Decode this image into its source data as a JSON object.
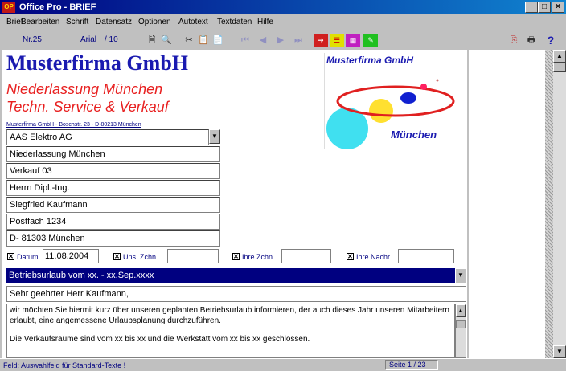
{
  "window": {
    "app_icon": "OP",
    "title": "Office Pro - BRIEF"
  },
  "menu": [
    "Brief",
    "Bearbeiten",
    "Schrift",
    "Datensatz",
    "Optionen",
    "Autotext",
    "Textdaten",
    "Hilfe"
  ],
  "toolbar": {
    "number": "Nr.25",
    "font": "Arial",
    "size": "/ 10",
    "help": "?"
  },
  "letterhead": {
    "company": "Musterfirma GmbH",
    "branch_line1": "Niederlassung München",
    "branch_line2": "Techn. Service & Verkauf",
    "sender_line": "Musterfirma GmbH - Boschstr. 23 - D-80213 München"
  },
  "logo": {
    "title": "Musterfirma GmbH",
    "city": "München"
  },
  "address": [
    "AAS Elektro AG",
    "Niederlassung München",
    "Verkauf 03",
    "Herrn Dipl.-Ing.",
    "Siegfried Kaufmann",
    "Postfach 1234",
    "D- 81303 München"
  ],
  "reference_fields": {
    "datum_label": "Datum",
    "datum_value": "11.08.2004",
    "uns_zchn_label": "Uns. Zchn.",
    "ihre_zchn_label": "Ihre Zchn.",
    "ihre_nachr_label": "Ihre Nachr."
  },
  "subject": "Betriebsurlaub vom xx. - xx.Sep.xxxx",
  "salutation": "Sehr geehrter Herr Kaufmann,",
  "body": {
    "paragraph1": "wir möchten Sie hiermit kurz über unseren geplanten Betriebsurlaub informieren, der auch dieses Jahr unseren Mitarbeitern erlaubt, eine angemessene Urlaubsplanung durchzuführen.",
    "paragraph2": "Die Verkaufsräume sind vom xx bis xx  und die Werkstatt vom xx bis xx geschlossen."
  },
  "status": {
    "message": "Feld: Auswahlfeld für Standard-Texte !",
    "page": "Seite 1 / 23"
  },
  "colors": {
    "accent": "#000080",
    "brand_blue": "#1a1ab0",
    "brand_red": "#e82020"
  }
}
